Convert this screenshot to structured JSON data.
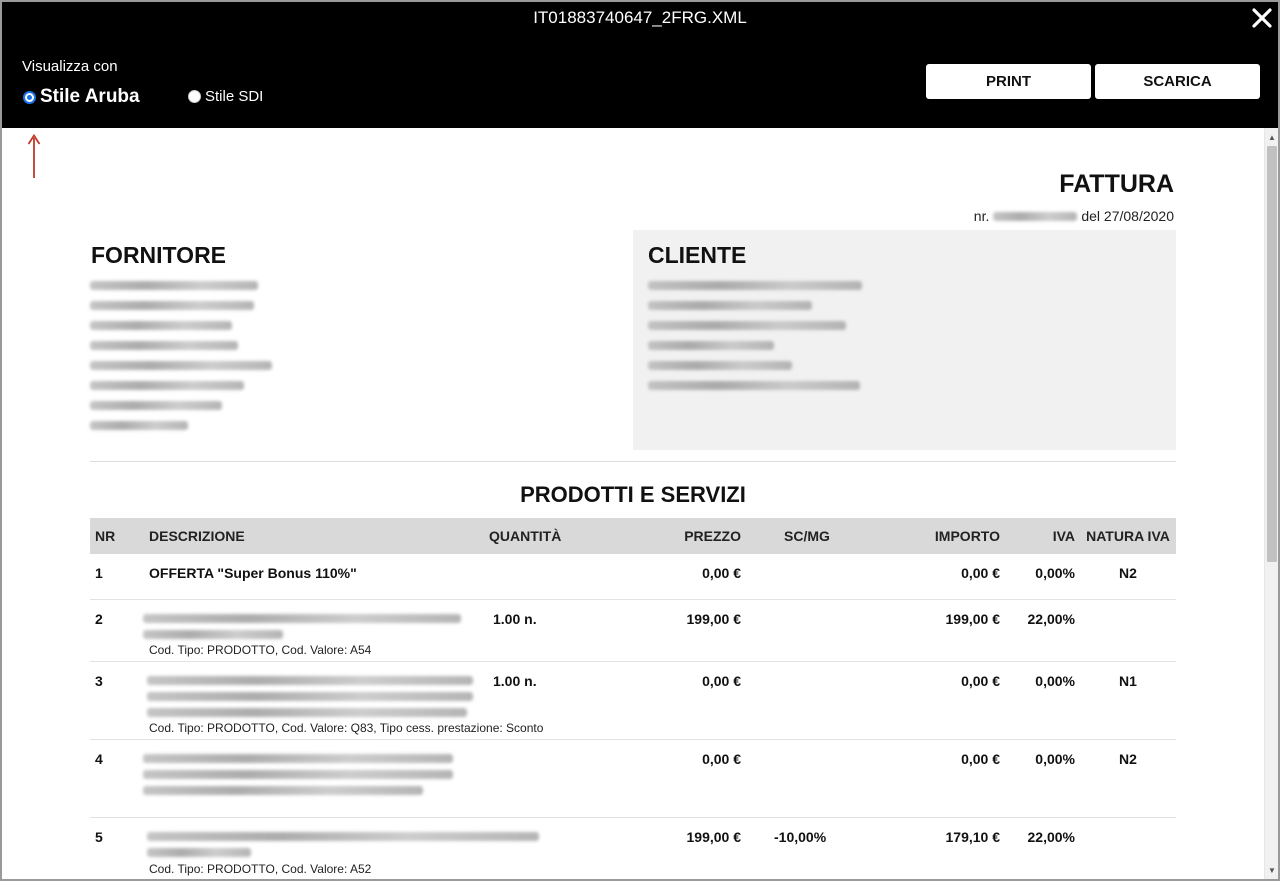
{
  "window": {
    "title": "IT01883740647_2FRG.XML",
    "close_icon": "close-icon"
  },
  "toolbar": {
    "view_label": "Visualizza con",
    "options": [
      {
        "label": "Stile Aruba",
        "selected": true
      },
      {
        "label": "Stile SDI",
        "selected": false
      }
    ],
    "print_label": "PRINT",
    "download_label": "SCARICA"
  },
  "annotation": {
    "arrow_icon": "arrow-up-icon",
    "color": "#c0392b"
  },
  "invoice": {
    "doc_type": "FATTURA",
    "number_prefix": "nr.",
    "date_text": "del 27/08/2020",
    "supplier_title": "FORNITORE",
    "customer_title": "CLIENTE",
    "section_title": "PRODOTTI E SERVIZI",
    "columns": [
      "NR",
      "DESCRIZIONE",
      "QUANTITÀ",
      "PREZZO",
      "SC/MG",
      "IMPORTO",
      "IVA",
      "NATURA IVA"
    ],
    "rows": [
      {
        "nr": "1",
        "description": "OFFERTA \"Super Bonus 110%\"",
        "quantity": "",
        "price": "0,00 €",
        "discount": "",
        "amount": "0,00 €",
        "vat": "0,00%",
        "nature": "N2",
        "note": ""
      },
      {
        "nr": "2",
        "description": "",
        "quantity": "1.00 n.",
        "price": "199,00 €",
        "discount": "",
        "amount": "199,00 €",
        "vat": "22,00%",
        "nature": "",
        "note": "Cod. Tipo: PRODOTTO, Cod. Valore: A54"
      },
      {
        "nr": "3",
        "description": "",
        "quantity": "1.00 n.",
        "price": "0,00 €",
        "discount": "",
        "amount": "0,00 €",
        "vat": "0,00%",
        "nature": "N1",
        "note": "Cod. Tipo: PRODOTTO, Cod. Valore: Q83, Tipo cess. prestazione: Sconto"
      },
      {
        "nr": "4",
        "description": "",
        "quantity": "",
        "price": "0,00 €",
        "discount": "",
        "amount": "0,00 €",
        "vat": "0,00%",
        "nature": "N2",
        "note": ""
      },
      {
        "nr": "5",
        "description": "",
        "quantity": "",
        "price": "199,00 €",
        "discount": "-10,00%",
        "amount": "179,10 €",
        "vat": "22,00%",
        "nature": "",
        "note": "Cod. Tipo: PRODOTTO, Cod. Valore: A52"
      }
    ]
  }
}
